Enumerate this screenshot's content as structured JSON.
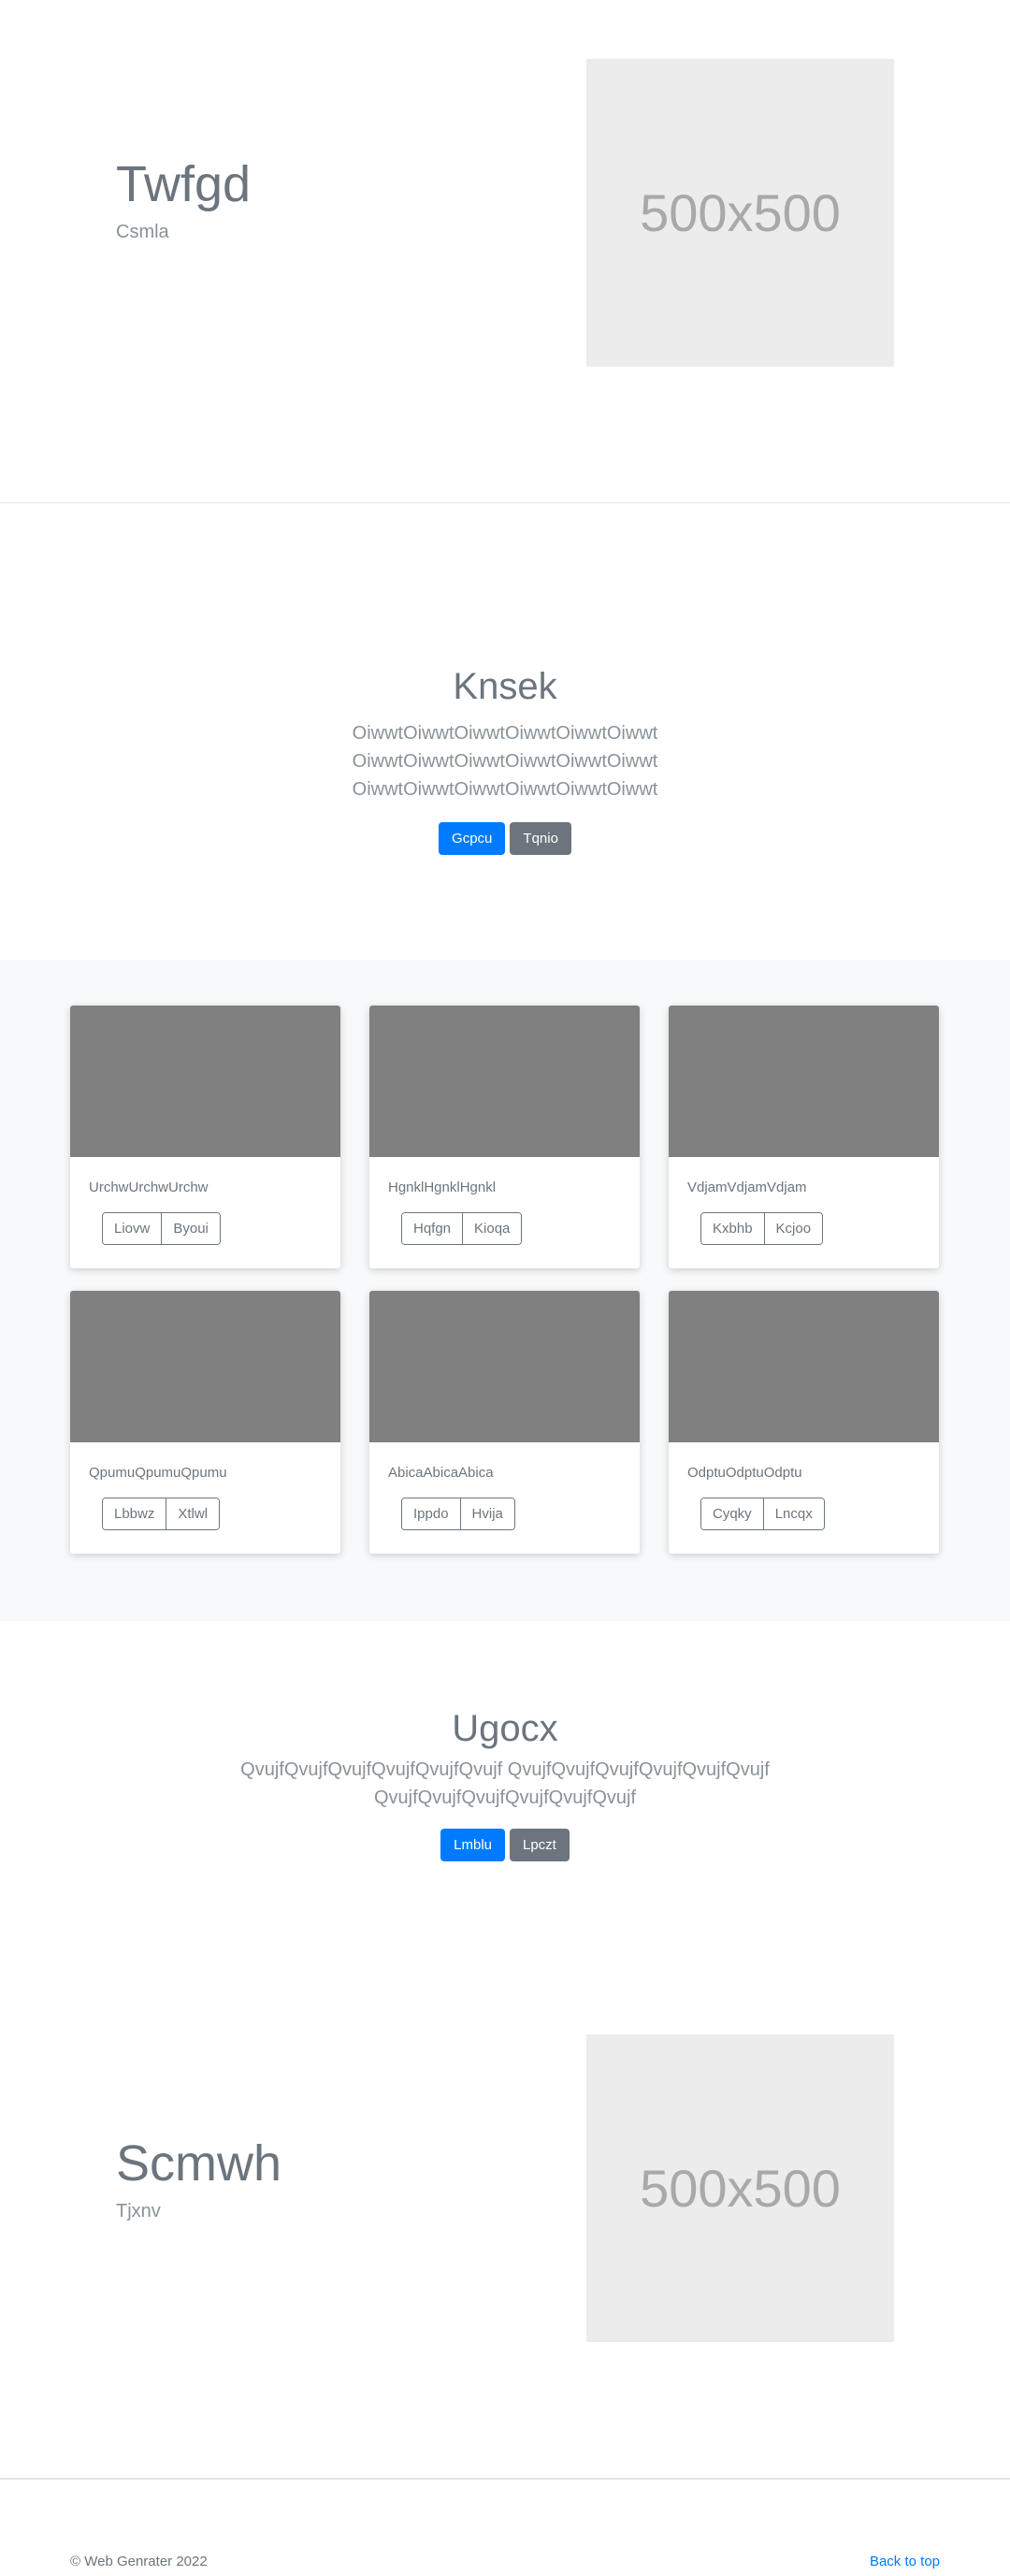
{
  "hero1": {
    "title": "Twfgd",
    "subtitle": "Csmla",
    "image_label": "500x500"
  },
  "section1": {
    "title": "Knsek",
    "lines": [
      "OiwwtOiwwtOiwwtOiwwtOiwwtOiwwt",
      "OiwwtOiwwtOiwwtOiwwtOiwwtOiwwt",
      "OiwwtOiwwtOiwwtOiwwtOiwwtOiwwt"
    ],
    "primary_label": "Gcpcu",
    "secondary_label": "Tqnio"
  },
  "cards": [
    {
      "text": "UrchwUrchwUrchw",
      "btn1": "Liovw",
      "btn2": "Byoui"
    },
    {
      "text": "HgnklHgnklHgnkl",
      "btn1": "Hqfgn",
      "btn2": "Kioqa"
    },
    {
      "text": "VdjamVdjamVdjam",
      "btn1": "Kxbhb",
      "btn2": "Kcjoo"
    },
    {
      "text": "QpumuQpumuQpumu",
      "btn1": "Lbbwz",
      "btn2": "Xtlwl"
    },
    {
      "text": "AbicaAbicaAbica",
      "btn1": "Ippdo",
      "btn2": "Hvija"
    },
    {
      "text": "OdptuOdptuOdptu",
      "btn1": "Cyqky",
      "btn2": "Lncqx"
    }
  ],
  "section2": {
    "title": "Ugocx",
    "lines": [
      "QvujfQvujfQvujfQvujfQvujfQvujf QvujfQvujfQvujfQvujfQvujfQvujf",
      "QvujfQvujfQvujfQvujfQvujfQvujf"
    ],
    "primary_label": "Lmblu",
    "secondary_label": "Lpczt"
  },
  "hero2": {
    "title": "Scmwh",
    "subtitle": "Tjxnv",
    "image_label": "500x500"
  },
  "footer": {
    "copyright": "© Web Genrater 2022",
    "back_to_top": "Back to top"
  }
}
